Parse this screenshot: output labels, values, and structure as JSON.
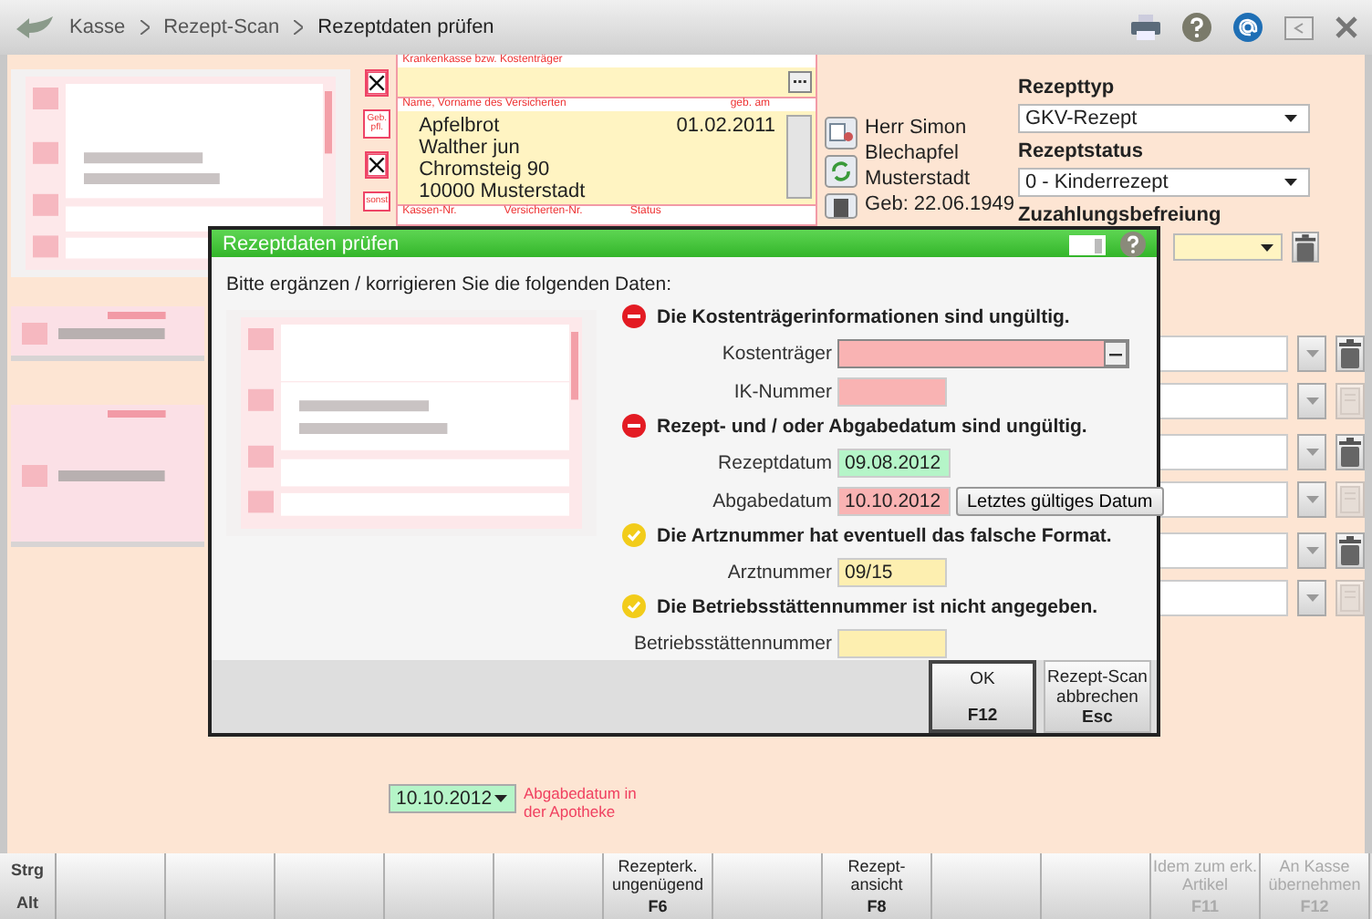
{
  "header": {
    "breadcrumbs": [
      "Kasse",
      "Rezept-Scan",
      "Rezeptdaten prüfen"
    ]
  },
  "scan_marks": [
    {
      "kind": "cross"
    },
    {
      "kind": "text",
      "label": "Geb. pfl."
    },
    {
      "kind": "cross"
    },
    {
      "kind": "text",
      "label": "sonst"
    }
  ],
  "payer_form": {
    "payer_label": "Krankenkasse bzw. Kostenträger",
    "name_label": "Name, Vorname des Versicherten",
    "birth_label": "geb. am",
    "address_lines": [
      "Apfelbrot",
      "Walther jun",
      "Chromsteig 90",
      "10000 Musterstadt"
    ],
    "birth_date": "01.02.2011",
    "footer_labels": [
      "Kassen-Nr.",
      "Versicherten-Nr.",
      "Status"
    ]
  },
  "patient": {
    "lines": [
      "Herr Simon",
      "Blechapfel",
      "Musterstadt",
      "Geb: 22.06.1949"
    ]
  },
  "prescription": {
    "type_label": "Rezepttyp",
    "type": "GKV-Rezept",
    "status_label": "Rezeptstatus",
    "status": "0 - Kinderrezept",
    "copay_label": "Zuzahlungsbefreiung"
  },
  "item_rows": [
    {
      "disabled": false
    },
    {
      "disabled": true
    },
    {
      "disabled": false
    },
    {
      "disabled": true
    },
    {
      "disabled": false
    },
    {
      "disabled": true
    }
  ],
  "dispense_date": {
    "value": "10.10.2012",
    "color": "#b5f5c8",
    "label": "Abgabedatum in der Apotheke"
  },
  "dialog": {
    "title": "Rezeptdaten prüfen",
    "intro": "Bitte ergänzen / korrigieren Sie die folgenden Daten:",
    "sections": [
      {
        "kind": "error",
        "message": "Die Kostenträgerinformationen sind ungültig.",
        "fields": [
          {
            "label": "Kostenträger",
            "kind": "lookup",
            "color": "#f9b3b3"
          },
          {
            "label": "IK-Nummer",
            "kind": "text",
            "color": "#f9b3b3"
          }
        ]
      },
      {
        "kind": "error",
        "message": "Rezept- und / oder Abgabedatum sind ungültig.",
        "fields": [
          {
            "label": "Rezeptdatum",
            "kind": "date",
            "color": "#b5f5c8",
            "value": "09.08.2012"
          },
          {
            "label": "Abgabedatum",
            "kind": "date",
            "color": "#f9b3b3",
            "value": "10.10.2012",
            "action": "Letztes gültiges Datum"
          }
        ]
      },
      {
        "kind": "warning",
        "message": "Die Artznummer hat eventuell das falsche Format.",
        "fields": [
          {
            "label": "Arztnummer",
            "kind": "text",
            "color": "#fdefb0",
            "value": "09/15"
          }
        ]
      },
      {
        "kind": "warning",
        "message": "Die Betriebsstättennummer ist nicht angegeben.",
        "fields": [
          {
            "label": "Betriebsstättennummer",
            "kind": "text",
            "color": "#fdefb0"
          }
        ]
      }
    ],
    "buttons": [
      {
        "label": "OK",
        "key": "F12",
        "default": true
      },
      {
        "label": "Rezept-Scan abbrechen",
        "key": "Esc",
        "default": false
      }
    ]
  },
  "function_keys": {
    "modifiers": [
      "Strg",
      "Alt"
    ],
    "keys": [
      {
        "kind": "blank"
      },
      {
        "kind": "blank"
      },
      {
        "kind": "blank"
      },
      {
        "kind": "blank"
      },
      {
        "kind": "blank"
      },
      {
        "kind": "action",
        "label": "Rezepterk. ungenügend",
        "key": "F6",
        "disabled": false
      },
      {
        "kind": "blank"
      },
      {
        "kind": "action",
        "label": "Rezept-ansicht",
        "key": "F8",
        "disabled": false
      },
      {
        "kind": "blank"
      },
      {
        "kind": "blank"
      },
      {
        "kind": "action",
        "label": "Idem zum erk. Artikel",
        "key": "F11",
        "disabled": true
      },
      {
        "kind": "action",
        "label": "An Kasse übernehmen",
        "key": "F12",
        "disabled": true
      }
    ]
  }
}
